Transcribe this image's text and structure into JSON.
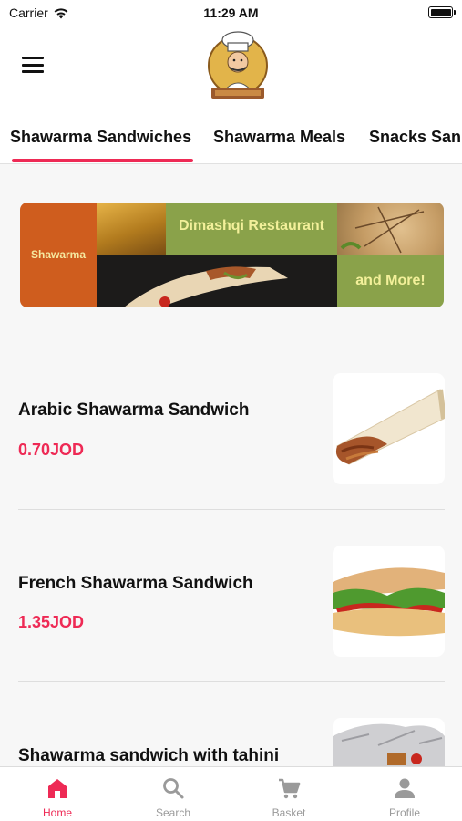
{
  "status_bar": {
    "carrier": "Carrier",
    "time": "11:29 AM"
  },
  "header": {
    "menu_icon": "hamburger-menu-icon",
    "logo_icon": "chef-logo-icon"
  },
  "category_tabs": [
    {
      "label": "Shawarma Sandwiches",
      "active": true
    },
    {
      "label": "Shawarma Meals",
      "active": false
    },
    {
      "label": "Snacks San",
      "active": false
    }
  ],
  "banner": {
    "left_text": "Shawarma",
    "title": "Dimashqi Restaurant",
    "subtitle": "and More!"
  },
  "products": [
    {
      "name": "Arabic Shawarma Sandwich",
      "price": "0.70JOD"
    },
    {
      "name": "French Shawarma Sandwich",
      "price": "1.35JOD"
    },
    {
      "name": "Shawarma sandwich with tahini",
      "price": ""
    }
  ],
  "bottom_tabs": [
    {
      "label": "Home",
      "icon": "home-icon",
      "active": true
    },
    {
      "label": "Search",
      "icon": "search-icon",
      "active": false
    },
    {
      "label": "Basket",
      "icon": "cart-icon",
      "active": false
    },
    {
      "label": "Profile",
      "icon": "person-icon",
      "active": false
    }
  ],
  "colors": {
    "accent": "#ee2a55",
    "banner_green": "#8aa24a",
    "banner_orange": "#cf5d1e"
  }
}
